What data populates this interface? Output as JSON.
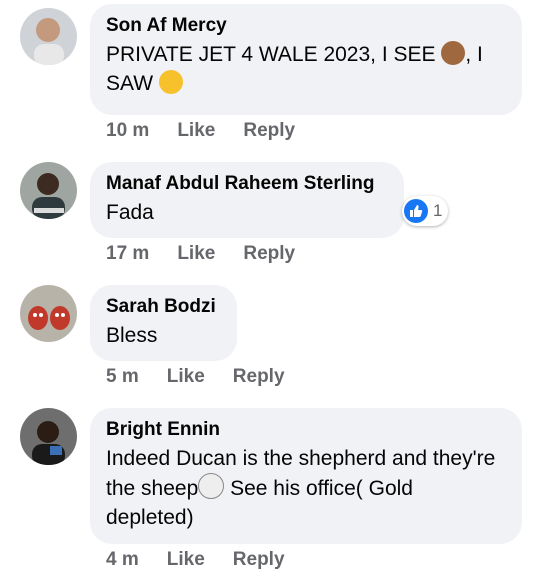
{
  "comments": [
    {
      "name": "Son Af Mercy",
      "text_part1": "PRIVATE JET 4 WALE 2023, I SEE ",
      "text_part2": ", I SAW ",
      "emoji1": "see-no-evil-monkey-icon",
      "emoji2": "money-mouth-face-icon",
      "time": "10 m",
      "like": "Like",
      "reply": "Reply"
    },
    {
      "name": "Manaf Abdul Raheem Sterling",
      "text": "Fada",
      "time": "17 m",
      "like": "Like",
      "reply": "Reply",
      "reaction_count": "1"
    },
    {
      "name": "Sarah Bodzi",
      "text": "Bless",
      "time": "5 m",
      "like": "Like",
      "reply": "Reply"
    },
    {
      "name": "Bright Ennin",
      "text_part1": "Indeed Ducan is the shepherd and they're the sheep",
      "text_part2": " See his office( Gold depleted)",
      "emoji": "sheep-icon",
      "time": "4 m",
      "like": "Like",
      "reply": "Reply"
    }
  ],
  "colors": {
    "bubble": "#f0f2f5",
    "meta_text": "#65676b",
    "like_blue": "#1877f2"
  }
}
